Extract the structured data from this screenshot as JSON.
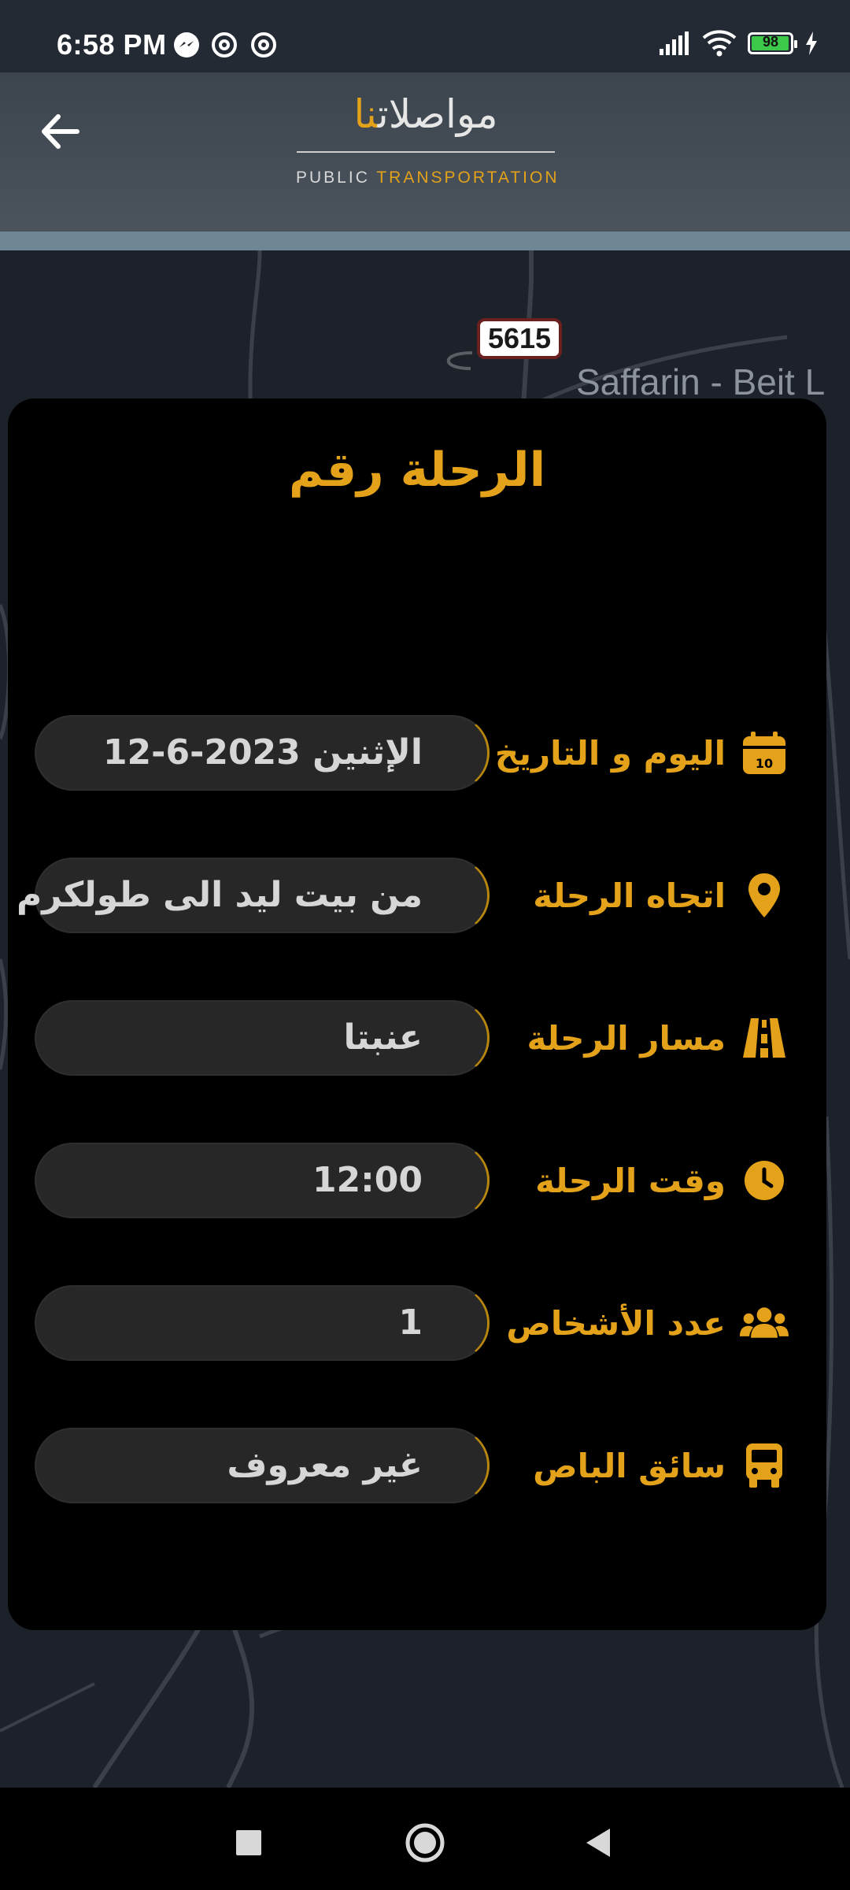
{
  "status_bar": {
    "time": "6:58 PM",
    "notifications": [
      "messenger-icon",
      "at-sign-icon",
      "at-sign-icon"
    ],
    "battery_level": "98",
    "battery_fraction": 0.98
  },
  "header": {
    "logo_arabic_main": "مواصلات",
    "logo_arabic_accent": "نا",
    "logo_sub_left": "PUBLIC",
    "logo_sub_right": "TRANSPORTATION",
    "accent_color": "#e3a21a"
  },
  "map": {
    "road_number": "5615",
    "place_label": "Saffarin - Beit L"
  },
  "trip": {
    "title": "الرحلة رقم",
    "rows": [
      {
        "label": "اليوم و التاريخ",
        "icon": "calendar-icon",
        "value": "الإثنين   2023-6-12"
      },
      {
        "label": "اتجاه الرحلة",
        "icon": "location-pin-icon",
        "value": "من بيت ليد الى طولكرم"
      },
      {
        "label": "مسار الرحلة",
        "icon": "road-icon",
        "value": "عنبتا"
      },
      {
        "label": "وقت الرحلة",
        "icon": "clock-icon",
        "value": "12:00"
      },
      {
        "label": "عدد الأشخاص",
        "icon": "people-icon",
        "value": "1"
      },
      {
        "label": "سائق الباص",
        "icon": "bus-icon",
        "value": "غير معروف"
      }
    ]
  },
  "nav": {
    "buttons": [
      "recent-apps-button",
      "home-button",
      "back-nav-button"
    ]
  }
}
